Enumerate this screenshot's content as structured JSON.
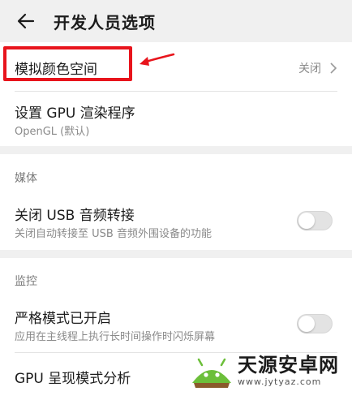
{
  "header": {
    "title": "开发人员选项",
    "back_icon": "arrow-left-icon"
  },
  "card1": {
    "color_space": {
      "title": "模拟颜色空间",
      "value": "关闭"
    },
    "gpu_renderer": {
      "title": "设置 GPU 渲染程序",
      "subtitle": "OpenGL (默认)"
    }
  },
  "media": {
    "section_label": "媒体",
    "usb_audio": {
      "title": "关闭 USB 音频转接",
      "subtitle": "关闭自动转接至 USB 音频外围设备的功能",
      "enabled": false
    }
  },
  "monitor": {
    "section_label": "监控",
    "strict_mode": {
      "title": "严格模式已开启",
      "subtitle": "应用在主线程上执行长时间操作时闪烁屏幕",
      "enabled": false
    },
    "gpu_profile": {
      "title": "GPU 呈现模式分析"
    }
  },
  "annotation": {
    "highlight_color": "#e8141c"
  },
  "watermark": {
    "title": "天源安卓网",
    "url": "www.jytyaz.com"
  }
}
